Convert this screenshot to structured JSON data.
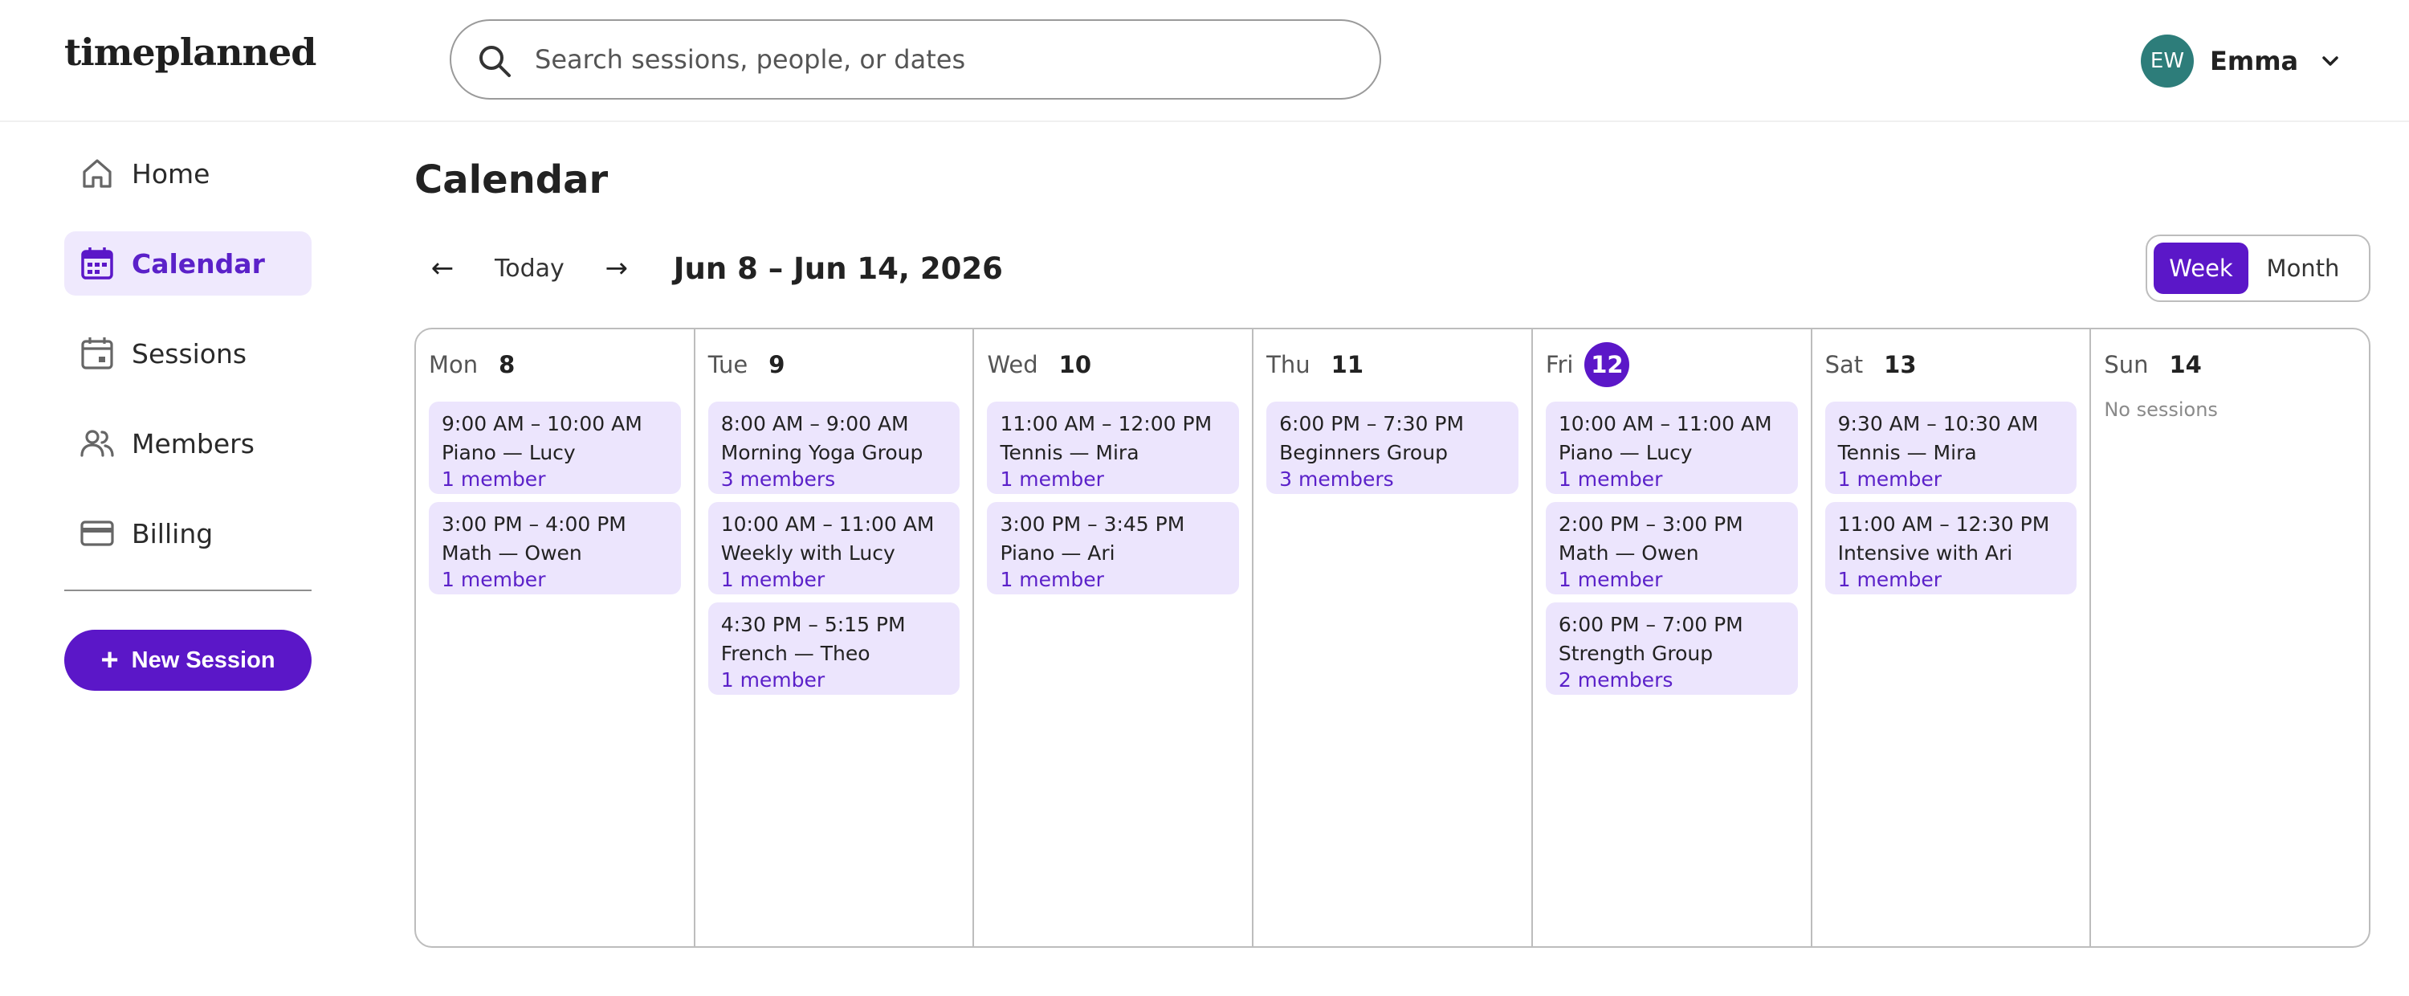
{
  "app": {
    "logo": "timeplanned"
  },
  "search": {
    "placeholder": "Search sessions, people, or dates",
    "value": ""
  },
  "user": {
    "initials": "EW",
    "name": "Emma"
  },
  "sidebar": {
    "items": [
      {
        "label": "Home",
        "icon": "home-icon"
      },
      {
        "label": "Calendar",
        "icon": "calendar-icon"
      },
      {
        "label": "Sessions",
        "icon": "sessions-icon"
      },
      {
        "label": "Members",
        "icon": "members-icon"
      },
      {
        "label": "Billing",
        "icon": "billing-icon"
      }
    ],
    "active": "Calendar",
    "new_session_label": "New Session"
  },
  "main": {
    "title": "Calendar",
    "prev_arrow": "←",
    "today_label": "Today",
    "next_arrow": "→",
    "range": "Jun 8 – Jun 14, 2026",
    "views": {
      "week": "Week",
      "month": "Month",
      "selected": "Week"
    }
  },
  "colors": {
    "accent": "#5b17c8",
    "event_bg": "#ece5fd",
    "avatar_bg": "#2d7d7a",
    "active_nav_bg": "#efe9fd"
  },
  "calendar": {
    "days": [
      {
        "name": "Mon",
        "num": "8",
        "today": false,
        "events": [
          {
            "time": "9:00 AM – 10:00 AM",
            "title": "Piano — Lucy",
            "members": "1 member"
          },
          {
            "time": "3:00 PM – 4:00 PM",
            "title": "Math — Owen",
            "members": "1 member"
          }
        ]
      },
      {
        "name": "Tue",
        "num": "9",
        "today": false,
        "events": [
          {
            "time": "8:00 AM – 9:00 AM",
            "title": "Morning Yoga Group",
            "members": "3 members"
          },
          {
            "time": "10:00 AM – 11:00 AM",
            "title": "Weekly with Lucy",
            "members": "1 member"
          },
          {
            "time": "4:30 PM – 5:15 PM",
            "title": "French — Theo",
            "members": "1 member"
          }
        ]
      },
      {
        "name": "Wed",
        "num": "10",
        "today": false,
        "events": [
          {
            "time": "11:00 AM – 12:00 PM",
            "title": "Tennis — Mira",
            "members": "1 member"
          },
          {
            "time": "3:00 PM – 3:45 PM",
            "title": "Piano — Ari",
            "members": "1 member"
          }
        ]
      },
      {
        "name": "Thu",
        "num": "11",
        "today": false,
        "events": [
          {
            "time": "6:00 PM – 7:30 PM",
            "title": "Beginners Group",
            "members": "3 members"
          }
        ]
      },
      {
        "name": "Fri",
        "num": "12",
        "today": true,
        "events": [
          {
            "time": "10:00 AM – 11:00 AM",
            "title": "Piano — Lucy",
            "members": "1 member"
          },
          {
            "time": "2:00 PM – 3:00 PM",
            "title": "Math — Owen",
            "members": "1 member"
          },
          {
            "time": "6:00 PM – 7:00 PM",
            "title": "Strength Group",
            "members": "2 members"
          }
        ]
      },
      {
        "name": "Sat",
        "num": "13",
        "today": false,
        "events": [
          {
            "time": "9:30 AM – 10:30 AM",
            "title": "Tennis — Mira",
            "members": "1 member"
          },
          {
            "time": "11:00 AM – 12:30 PM",
            "title": "Intensive with Ari",
            "members": "1 member"
          }
        ]
      },
      {
        "name": "Sun",
        "num": "14",
        "today": false,
        "events": [],
        "empty_label": "No sessions"
      }
    ]
  }
}
